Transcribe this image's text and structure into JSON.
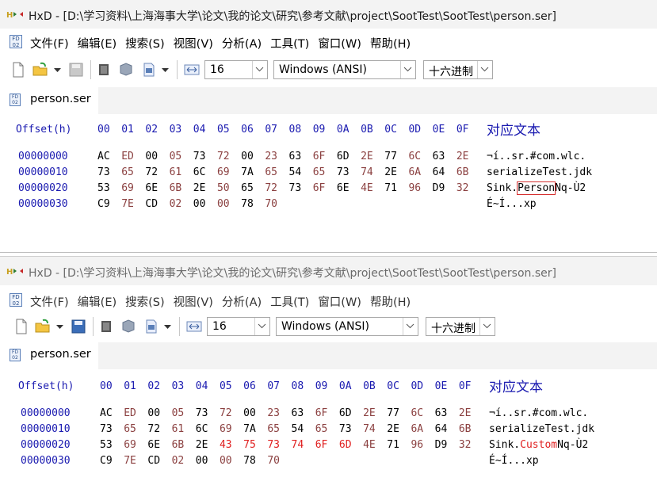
{
  "colors": {
    "accent": "#1a1ab0",
    "highlight": "#e02020",
    "odd_byte": "#8b4040"
  },
  "top": {
    "title": "HxD - [D:\\学习资料\\上海海事大学\\论文\\我的论文\\研究\\参考文献\\project\\SootTest\\SootTest\\person.ser]",
    "menu": [
      "文件(F)",
      "编辑(E)",
      "搜索(S)",
      "视图(V)",
      "分析(A)",
      "工具(T)",
      "窗口(W)",
      "帮助(H)"
    ],
    "toolbar": {
      "bytes_per_row": "16",
      "charset": "Windows (ANSI)",
      "offset_base": "十六进制"
    },
    "tab": "person.ser",
    "header": {
      "offset": "Offset(h)",
      "text_col": "对应文本",
      "cols": [
        "00",
        "01",
        "02",
        "03",
        "04",
        "05",
        "06",
        "07",
        "08",
        "09",
        "0A",
        "0B",
        "0C",
        "0D",
        "0E",
        "0F"
      ]
    },
    "rows": [
      {
        "offset": "00000000",
        "bytes": [
          "AC",
          "ED",
          "00",
          "05",
          "73",
          "72",
          "00",
          "23",
          "63",
          "6F",
          "6D",
          "2E",
          "77",
          "6C",
          "63",
          "2E"
        ],
        "text_a": "¬í..sr.#com.wlc.",
        "text_b": "",
        "text_c": ""
      },
      {
        "offset": "00000010",
        "bytes": [
          "73",
          "65",
          "72",
          "61",
          "6C",
          "69",
          "7A",
          "65",
          "54",
          "65",
          "73",
          "74",
          "2E",
          "6A",
          "64",
          "6B"
        ],
        "text_a": "serializeTest.jdk",
        "text_b": "",
        "text_c": ""
      },
      {
        "offset": "00000020",
        "bytes": [
          "53",
          "69",
          "6E",
          "6B",
          "2E",
          "50",
          "65",
          "72",
          "73",
          "6F",
          "6E",
          "4E",
          "71",
          "96",
          "D9",
          "32"
        ],
        "text_a": "Sink.",
        "text_b": "Person",
        "text_c": "Nq-Ù2"
      },
      {
        "offset": "00000030",
        "bytes": [
          "C9",
          "7E",
          "CD",
          "02",
          "00",
          "00",
          "78",
          "70"
        ],
        "text_a": "É~Í...xp",
        "text_b": "",
        "text_c": ""
      }
    ]
  },
  "bottom": {
    "title": "HxD - [D:\\学习资料\\上海海事大学\\论文\\我的论文\\研究\\参考文献\\project\\SootTest\\SootTest\\person.ser]",
    "menu": [
      "文件(F)",
      "编辑(E)",
      "搜索(S)",
      "视图(V)",
      "分析(A)",
      "工具(T)",
      "窗口(W)",
      "帮助(H)"
    ],
    "toolbar": {
      "bytes_per_row": "16",
      "charset": "Windows (ANSI)",
      "offset_base": "十六进制"
    },
    "tab": "person.ser",
    "header": {
      "offset": "Offset(h)",
      "text_col": "对应文本",
      "cols": [
        "00",
        "01",
        "02",
        "03",
        "04",
        "05",
        "06",
        "07",
        "08",
        "09",
        "0A",
        "0B",
        "0C",
        "0D",
        "0E",
        "0F"
      ]
    },
    "rows": [
      {
        "offset": "00000000",
        "bytes": [
          "AC",
          "ED",
          "00",
          "05",
          "73",
          "72",
          "00",
          "23",
          "63",
          "6F",
          "6D",
          "2E",
          "77",
          "6C",
          "63",
          "2E"
        ],
        "text_a": "¬í..sr.#com.wlc.",
        "text_b": "",
        "text_c": ""
      },
      {
        "offset": "00000010",
        "bytes": [
          "73",
          "65",
          "72",
          "61",
          "6C",
          "69",
          "7A",
          "65",
          "54",
          "65",
          "73",
          "74",
          "2E",
          "6A",
          "64",
          "6B"
        ],
        "text_a": "serializeTest.jdk",
        "text_b": "",
        "text_c": ""
      },
      {
        "offset": "00000020",
        "bytes": [
          "53",
          "69",
          "6E",
          "6B",
          "2E",
          "43",
          "75",
          "73",
          "74",
          "6F",
          "6D",
          "4E",
          "71",
          "96",
          "D9",
          "32"
        ],
        "text_a": "Sink.",
        "text_b": "Custom",
        "text_c": "Nq-Ù2"
      },
      {
        "offset": "00000030",
        "bytes": [
          "C9",
          "7E",
          "CD",
          "02",
          "00",
          "00",
          "78",
          "70"
        ],
        "text_a": "É~Í...xp",
        "text_b": "",
        "text_c": ""
      }
    ]
  }
}
